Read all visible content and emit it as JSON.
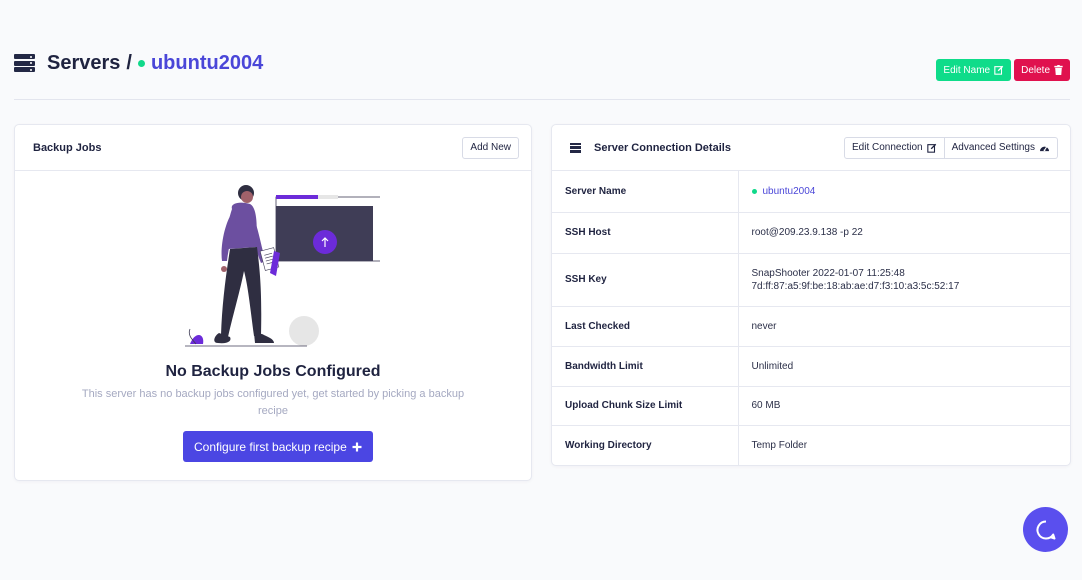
{
  "header": {
    "root": "Servers",
    "separator": "/",
    "current": "ubuntu2004",
    "edit_name": "Edit Name",
    "delete": "Delete"
  },
  "backup_jobs": {
    "title": "Backup Jobs",
    "add_new": "Add New",
    "empty_title": "No Backup Jobs Configured",
    "empty_desc": "This server has no backup jobs configured yet, get started by picking a backup recipe",
    "cta": "Configure first backup recipe"
  },
  "connection": {
    "title": "Server Connection Details",
    "edit_connection": "Edit Connection",
    "advanced_settings": "Advanced Settings",
    "rows": [
      {
        "label": "Server Name",
        "value": "ubuntu2004"
      },
      {
        "label": "SSH Host",
        "value": "root@209.23.9.138 -p 22"
      },
      {
        "label": "SSH Key",
        "value": "SnapShooter 2022-01-07 11:25:48",
        "value2": "7d:ff:87:a5:9f:be:18:ab:ae:d7:f3:10:a3:5c:52:17"
      },
      {
        "label": "Last Checked",
        "value": "never"
      },
      {
        "label": "Bandwidth Limit",
        "value": "Unlimited"
      },
      {
        "label": "Upload Chunk Size Limit",
        "value": "60 MB"
      },
      {
        "label": "Working Directory",
        "value": "Temp Folder"
      }
    ]
  },
  "colors": {
    "accent": "#4b46e3",
    "success": "#0fdc8a",
    "danger": "#e0114e",
    "illustration_purple": "#6c2bd9"
  }
}
